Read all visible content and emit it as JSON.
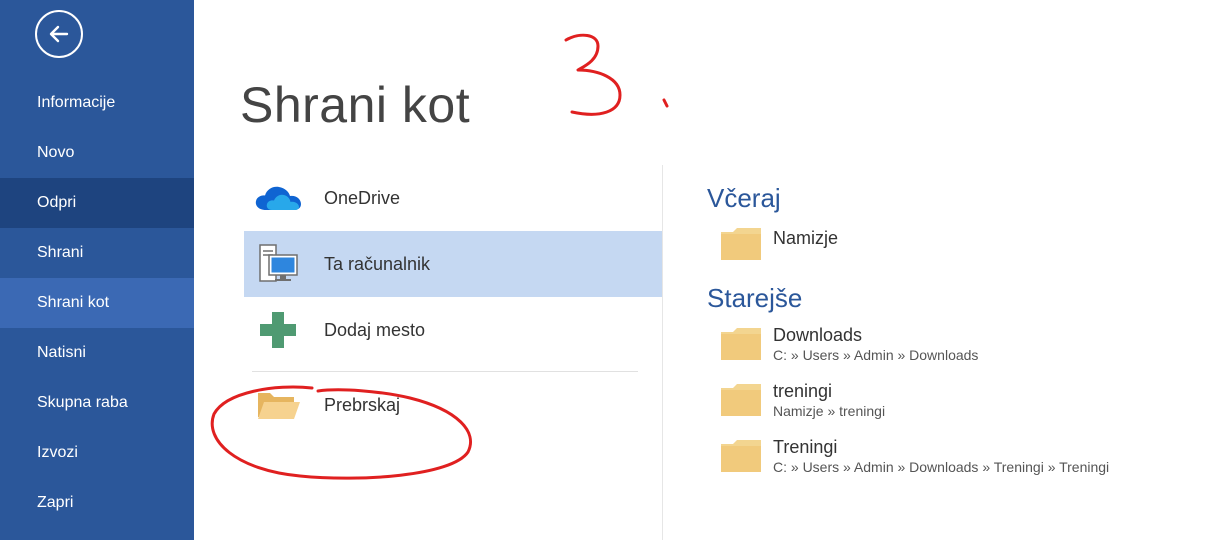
{
  "window": {
    "title": "Shrani kot"
  },
  "sidebar": {
    "items": [
      {
        "label": "Informacije"
      },
      {
        "label": "Novo"
      },
      {
        "label": "Odpri"
      },
      {
        "label": "Shrani"
      },
      {
        "label": "Shrani kot"
      },
      {
        "label": "Natisni"
      },
      {
        "label": "Skupna raba"
      },
      {
        "label": "Izvozi"
      },
      {
        "label": "Zapri"
      }
    ],
    "hover_item": "Odpri",
    "active_item": "Shrani kot"
  },
  "locations": [
    {
      "label": "OneDrive",
      "icon": "cloud-icon"
    },
    {
      "label": "Ta računalnik",
      "icon": "computer-icon"
    },
    {
      "label": "Dodaj mesto",
      "icon": "plus-icon"
    },
    {
      "label": "Prebrskaj",
      "icon": "folder-open-icon"
    }
  ],
  "recent": {
    "groups": [
      {
        "heading": "Včeraj",
        "folders": [
          {
            "name": "Namizje",
            "path": ""
          }
        ]
      },
      {
        "heading": "Starejše",
        "folders": [
          {
            "name": "Downloads",
            "path": "C: » Users » Admin » Downloads"
          },
          {
            "name": "treningi",
            "path": "Namizje » treningi"
          },
          {
            "name": "Treningi",
            "path": "C: » Users » Admin » Downloads » Treningi » Treningi"
          }
        ]
      }
    ]
  },
  "annotation": {
    "handwritten": "3",
    "color": "#e02020"
  },
  "colors": {
    "sidebar": "#2b579a",
    "sidebar_hover": "#1e447f",
    "sidebar_active": "#3b69b4",
    "selected_location": "#c5d8f2",
    "accent": "#2b579a",
    "folder": "#f2c97a"
  }
}
